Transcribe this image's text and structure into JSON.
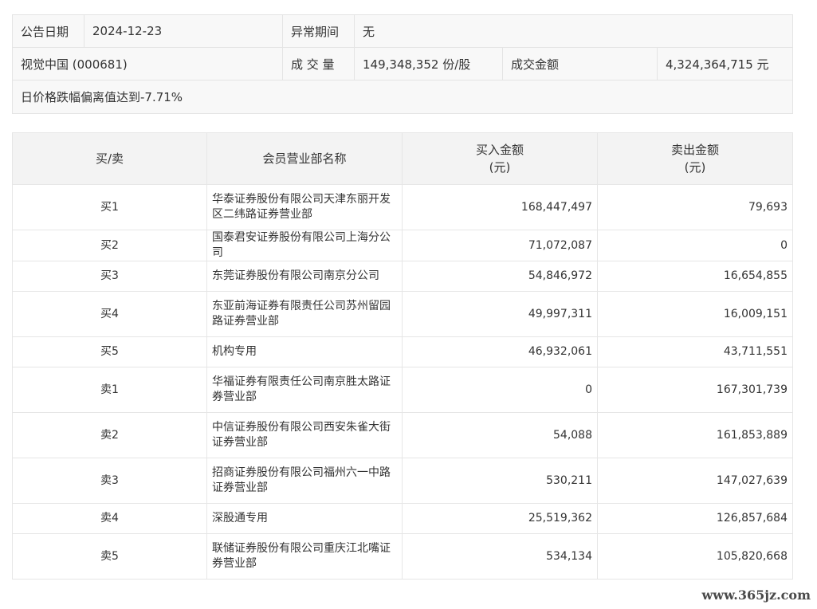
{
  "info": {
    "announce_date_label": "公告日期",
    "announce_date_value": "2024-12-23",
    "abnormal_period_label": "异常期间",
    "abnormal_period_value": "无",
    "stock_name": "视觉中国 (000681)",
    "volume_label": "成 交 量",
    "volume_value": "149,348,352 份/股",
    "turnover_label": "成交金额",
    "turnover_value": "4,324,364,715 元",
    "reason": "日价格跌幅偏离值达到-7.71%"
  },
  "table": {
    "headers": {
      "side": "买/卖",
      "branch": "会员营业部名称",
      "buy_line1": "买入金额",
      "buy_line2": "(元)",
      "sell_line1": "卖出金额",
      "sell_line2": "(元)"
    },
    "rows": [
      {
        "side": "买1",
        "branch": "华泰证券股份有限公司天津东丽开发区二纬路证券营业部",
        "buy": "168,447,497",
        "sell": "79,693"
      },
      {
        "side": "买2",
        "branch": "国泰君安证券股份有限公司上海分公司",
        "buy": "71,072,087",
        "sell": "0"
      },
      {
        "side": "买3",
        "branch": "东莞证券股份有限公司南京分公司",
        "buy": "54,846,972",
        "sell": "16,654,855"
      },
      {
        "side": "买4",
        "branch": "东亚前海证券有限责任公司苏州留园路证券营业部",
        "buy": "49,997,311",
        "sell": "16,009,151"
      },
      {
        "side": "买5",
        "branch": "机构专用",
        "buy": "46,932,061",
        "sell": "43,711,551"
      },
      {
        "side": "卖1",
        "branch": "华福证券有限责任公司南京胜太路证券营业部",
        "buy": "0",
        "sell": "167,301,739"
      },
      {
        "side": "卖2",
        "branch": "中信证券股份有限公司西安朱雀大街证券营业部",
        "buy": "54,088",
        "sell": "161,853,889"
      },
      {
        "side": "卖3",
        "branch": "招商证券股份有限公司福州六一中路证券营业部",
        "buy": "530,211",
        "sell": "147,027,639"
      },
      {
        "side": "卖4",
        "branch": "深股通专用",
        "buy": "25,519,362",
        "sell": "126,857,684"
      },
      {
        "side": "卖5",
        "branch": "联储证券股份有限公司重庆江北嘴证券营业部",
        "buy": "534,134",
        "sell": "105,820,668"
      }
    ]
  },
  "watermark": "www.365jz.com"
}
